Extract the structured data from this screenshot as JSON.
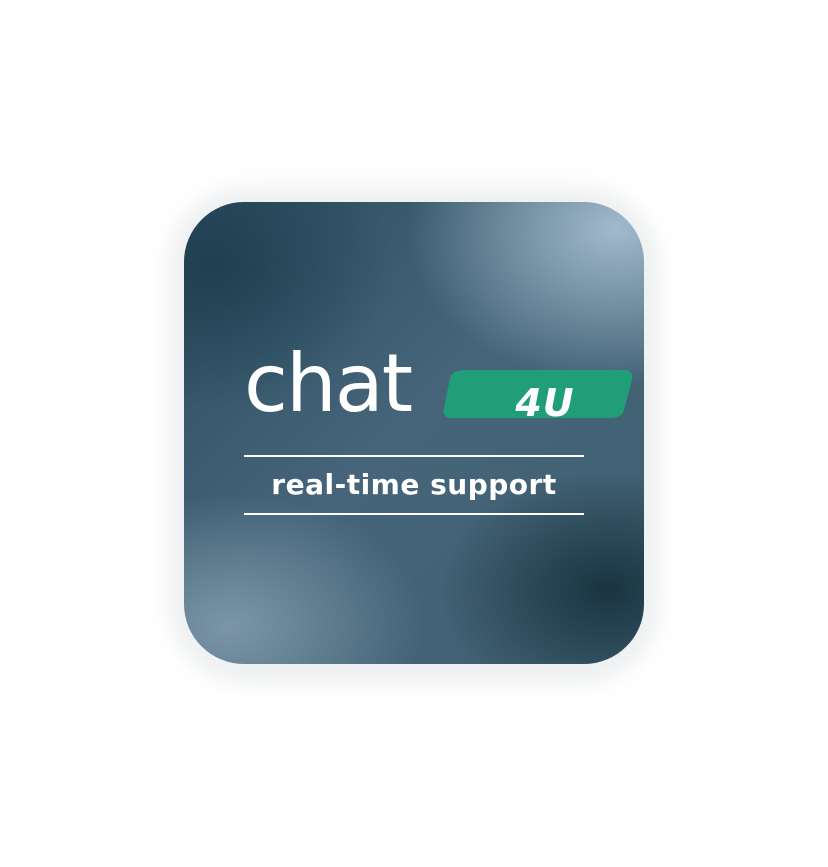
{
  "logo": {
    "word": "chat",
    "badge_text": "4U",
    "tagline": "real-time support"
  },
  "colors": {
    "badge_green": "#1f9e78",
    "text": "#ffffff",
    "tile_dark": "#2a4b5e",
    "tile_light": "#a6bed0"
  }
}
